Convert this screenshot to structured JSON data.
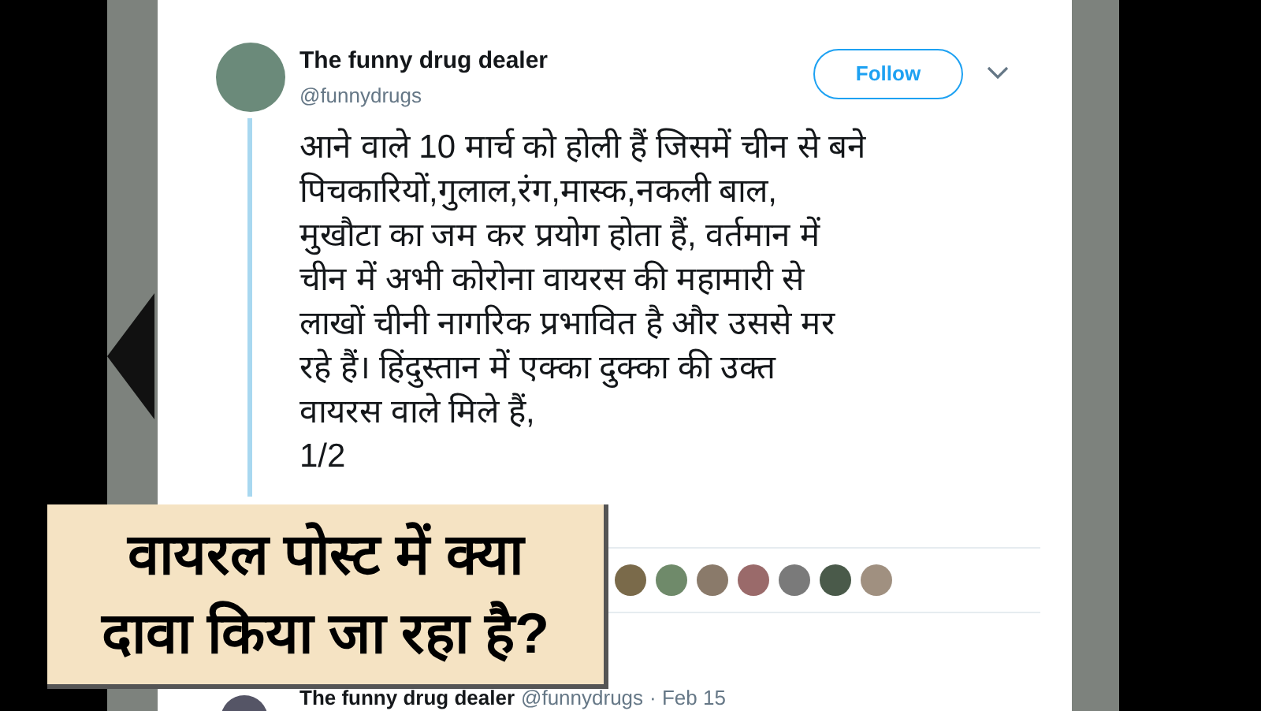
{
  "tweet": {
    "author": "The funny drug dealer",
    "handle": "@funnydrugs",
    "follow_button": "Follow",
    "text_lines": [
      "आने वाले 10 मार्च को होली हैं जिसमें चीन से बने",
      "पिचकारियों,गुलाल,रंग,मास्क,नकली बाल,",
      "मुखौटा का जम कर प्रयोग होता हैं, वर्तमान में",
      "चीन में अभी कोरोना वायरस की महामारी से",
      "लाखों चीनी नागरिक प्रभावित है और उससे मर",
      "रहे हैं। हिंदुस्तान में एक्का दुक्का की उक्त",
      "वायरस वाले मिले हैं,",
      "1/2"
    ]
  },
  "caption_lines": [
    "वायरल पोस्ट में क्या",
    "दावा किया जा रहा है?"
  ],
  "next_tweet": {
    "author": "The funny drug dealer",
    "handle": "@funnydrugs",
    "time": "· Feb 15"
  }
}
